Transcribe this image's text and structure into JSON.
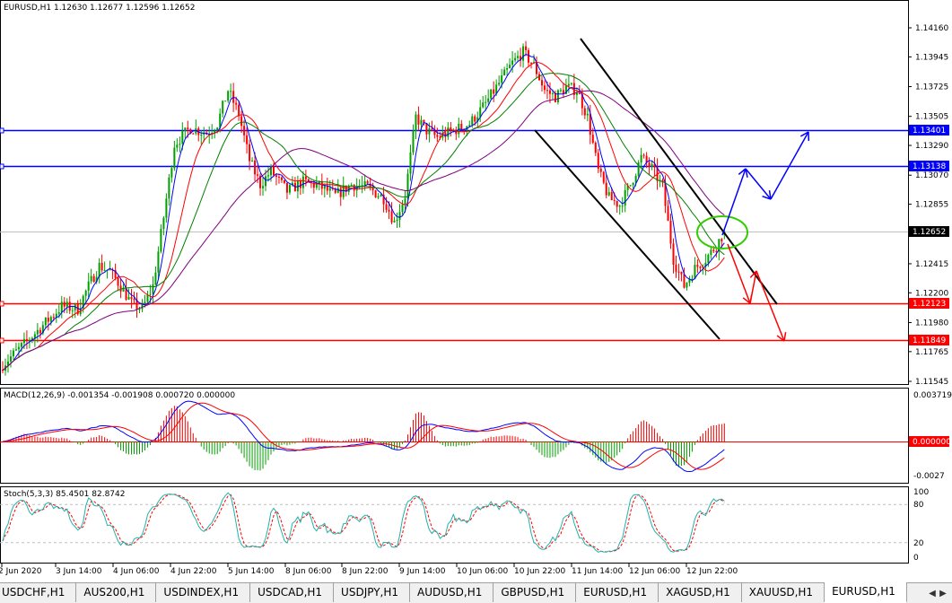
{
  "main_header": "EURUSD,H1  1.12630 1.12677 1.12596 1.12652",
  "macd_header": "MACD(12,26,9) -0.001354 -0.001908 0.000720 0.000000",
  "stoch_header": "Stoch(5,3,3) 85.4501 82.8742",
  "price_axis": [
    "1.14160",
    "1.13945",
    "1.13725",
    "1.13505",
    "1.13290",
    "1.13070",
    "1.12855",
    "1.12415",
    "1.12200",
    "1.11980",
    "1.11765",
    "1.11545"
  ],
  "price_labels": {
    "current": "1.12652",
    "blue_high": "1.13401",
    "blue_low": "1.13138",
    "red_high": "1.12123",
    "red_low": "1.11849"
  },
  "macd_axis": {
    "top": "0.003719",
    "zero": "0.000000",
    "bottom": "-0.0027"
  },
  "stoch_axis": {
    "top": "100",
    "upper": "80",
    "lower": "20",
    "bottom": "0"
  },
  "time_axis": [
    "2 Jun 2020",
    "3 Jun 14:00",
    "4 Jun 06:00",
    "4 Jun 22:00",
    "5 Jun 14:00",
    "8 Jun 06:00",
    "8 Jun 22:00",
    "9 Jun 14:00",
    "10 Jun 06:00",
    "10 Jun 22:00",
    "11 Jun 14:00",
    "12 Jun 06:00",
    "12 Jun 22:00"
  ],
  "tabs": [
    "USDCHF,H1",
    "AUS200,H1",
    "USDINDEX,H1",
    "USDCAD,H1",
    "USDJPY,H1",
    "AUDUSD,H1",
    "GBPUSD,H1",
    "EURUSD,H1",
    "XAGUSD,H1",
    "XAUUSD,H1",
    "EURUSD,H1"
  ],
  "active_tab": 10,
  "colors": {
    "bull": "#00a000",
    "bear": "#ff0000",
    "blue_line": "#0000ff",
    "red_line": "#ff0000",
    "ma_blue": "#0000ff",
    "ma_red": "#ff0000",
    "ma_green": "#008000",
    "ma_purple": "#800080",
    "macd_main": "#0000ff",
    "macd_signal": "#ff0000",
    "stoch_main": "#20b2aa",
    "stoch_signal": "#ff0000",
    "ellipse": "#33cc00",
    "channel": "#000000"
  },
  "chart_data": [
    {
      "type": "candlestick",
      "symbol": "EURUSD",
      "timeframe": "H1",
      "title": "EURUSD,H1  1.12630 1.12677 1.12596 1.12652",
      "ylim": [
        1.115,
        1.1426
      ],
      "xlim": [
        "2 Jun 2020",
        "13 Jun 2020"
      ],
      "y_ticks": [
        1.1416,
        1.13945,
        1.13725,
        1.13505,
        1.1329,
        1.1307,
        1.12855,
        1.12415,
        1.122,
        1.1198,
        1.11765,
        1.11545
      ],
      "x_ticks": [
        "2 Jun 2020",
        "3 Jun 14:00",
        "4 Jun 06:00",
        "4 Jun 22:00",
        "5 Jun 14:00",
        "8 Jun 06:00",
        "8 Jun 22:00",
        "9 Jun 14:00",
        "10 Jun 06:00",
        "10 Jun 22:00",
        "11 Jun 14:00",
        "12 Jun 06:00",
        "12 Jun 22:00"
      ],
      "close_path": [
        [
          0,
          1.1167
        ],
        [
          8,
          1.1182
        ],
        [
          16,
          1.1198
        ],
        [
          22,
          1.121
        ],
        [
          28,
          1.1208
        ],
        [
          32,
          1.1225
        ],
        [
          36,
          1.124
        ],
        [
          40,
          1.1236
        ],
        [
          44,
          1.1225
        ],
        [
          48,
          1.1212
        ],
        [
          52,
          1.1208
        ],
        [
          56,
          1.1225
        ],
        [
          60,
          1.1276
        ],
        [
          64,
          1.133
        ],
        [
          70,
          1.1342
        ],
        [
          76,
          1.1338
        ],
        [
          80,
          1.1345
        ],
        [
          84,
          1.137
        ],
        [
          88,
          1.1352
        ],
        [
          92,
          1.1318
        ],
        [
          96,
          1.13
        ],
        [
          100,
          1.131
        ],
        [
          106,
          1.1295
        ],
        [
          112,
          1.1302
        ],
        [
          118,
          1.1299
        ],
        [
          124,
          1.1292
        ],
        [
          130,
          1.13
        ],
        [
          136,
          1.1298
        ],
        [
          142,
          1.129
        ],
        [
          146,
          1.1272
        ],
        [
          150,
          1.1292
        ],
        [
          154,
          1.135
        ],
        [
          158,
          1.134
        ],
        [
          162,
          1.1335
        ],
        [
          168,
          1.134
        ],
        [
          174,
          1.1345
        ],
        [
          180,
          1.136
        ],
        [
          186,
          1.1378
        ],
        [
          190,
          1.139
        ],
        [
          194,
          1.1398
        ],
        [
          198,
          1.1388
        ],
        [
          202,
          1.137
        ],
        [
          206,
          1.1365
        ],
        [
          210,
          1.1372
        ],
        [
          214,
          1.137
        ],
        [
          218,
          1.135
        ],
        [
          222,
          1.131
        ],
        [
          226,
          1.129
        ],
        [
          230,
          1.1285
        ],
        [
          234,
          1.13
        ],
        [
          238,
          1.132
        ],
        [
          242,
          1.1312
        ],
        [
          246,
          1.1298
        ],
        [
          250,
          1.1245
        ],
        [
          254,
          1.1225
        ],
        [
          258,
          1.1238
        ],
        [
          262,
          1.1245
        ],
        [
          266,
          1.1255
        ],
        [
          269,
          1.12652
        ]
      ],
      "horizontal_levels": [
        {
          "value": 1.13401,
          "color": "blue"
        },
        {
          "value": 1.13138,
          "color": "blue"
        },
        {
          "value": 1.12123,
          "color": "red"
        },
        {
          "value": 1.11849,
          "color": "red"
        }
      ],
      "current_price": 1.12652,
      "moving_averages": [
        "blue",
        "red",
        "green",
        "purple"
      ],
      "annotations": [
        "descending channel (black)",
        "green ellipse at breakout point",
        "blue bullish projection arrows",
        "red bearish projection arrows"
      ]
    },
    {
      "type": "line",
      "title": "MACD(12,26,9) -0.001354 -0.001908 0.000720 0.000000",
      "ylim": [
        -0.0027,
        0.003719
      ],
      "series": [
        {
          "name": "MACD",
          "values": "histogram"
        },
        {
          "name": "Signal",
          "values": "line"
        }
      ],
      "last_values": {
        "main": -0.001354,
        "signal": -0.001908,
        "hist": 0.00072
      }
    },
    {
      "type": "line",
      "title": "Stoch(5,3,3) 85.4501 82.8742",
      "ylim": [
        0,
        100
      ],
      "levels": [
        20,
        80
      ],
      "last_values": {
        "main": 85.4501,
        "signal": 82.8742
      }
    }
  ]
}
